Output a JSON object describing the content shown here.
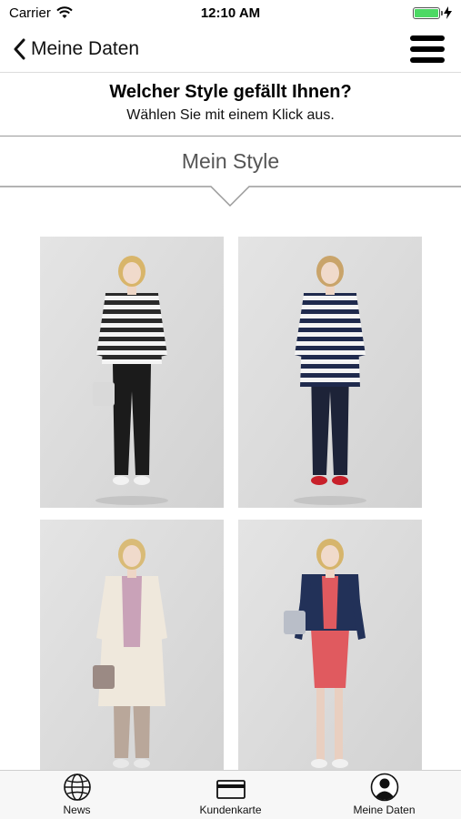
{
  "status_bar": {
    "carrier": "Carrier",
    "time": "12:10 AM",
    "battery_level": 1.0
  },
  "nav": {
    "back_label": "Meine Daten"
  },
  "question": {
    "title": "Welcher Style gefällt Ihnen?",
    "subtitle": "Wählen Sie mit einem Klick aus."
  },
  "section": {
    "title": "Mein Style"
  },
  "styles": [
    {
      "id": "style-1",
      "top": "striped",
      "top_color": "#2a2a2a",
      "bottom_color": "#1b1b1b",
      "hair": "#d8b56a",
      "bag": "#d9d9d9",
      "shoes": "#f2f2f2"
    },
    {
      "id": "style-2",
      "top": "striped",
      "top_color": "#1f2a4d",
      "bottom_color": "#1d2338",
      "hair": "#c9a46a",
      "bag": "",
      "shoes": "#c8202a"
    },
    {
      "id": "style-3",
      "top": "cardigan",
      "top_color": "#efe8dc",
      "bottom_color": "#b9a79a",
      "hair": "#d9bb77",
      "bag": "#9b8a84",
      "shoes": "#e8e8e8"
    },
    {
      "id": "style-4",
      "top": "jacket",
      "top_color": "#223158",
      "bottom_color": "#e05a5f",
      "hair": "#d6b56c",
      "bag": "#b9bec8",
      "shoes": "#f0f0f0"
    }
  ],
  "tabs": [
    {
      "label": "News",
      "icon": "globe-icon"
    },
    {
      "label": "Kundenkarte",
      "icon": "card-icon"
    },
    {
      "label": "Meine Daten",
      "icon": "person-icon"
    }
  ]
}
